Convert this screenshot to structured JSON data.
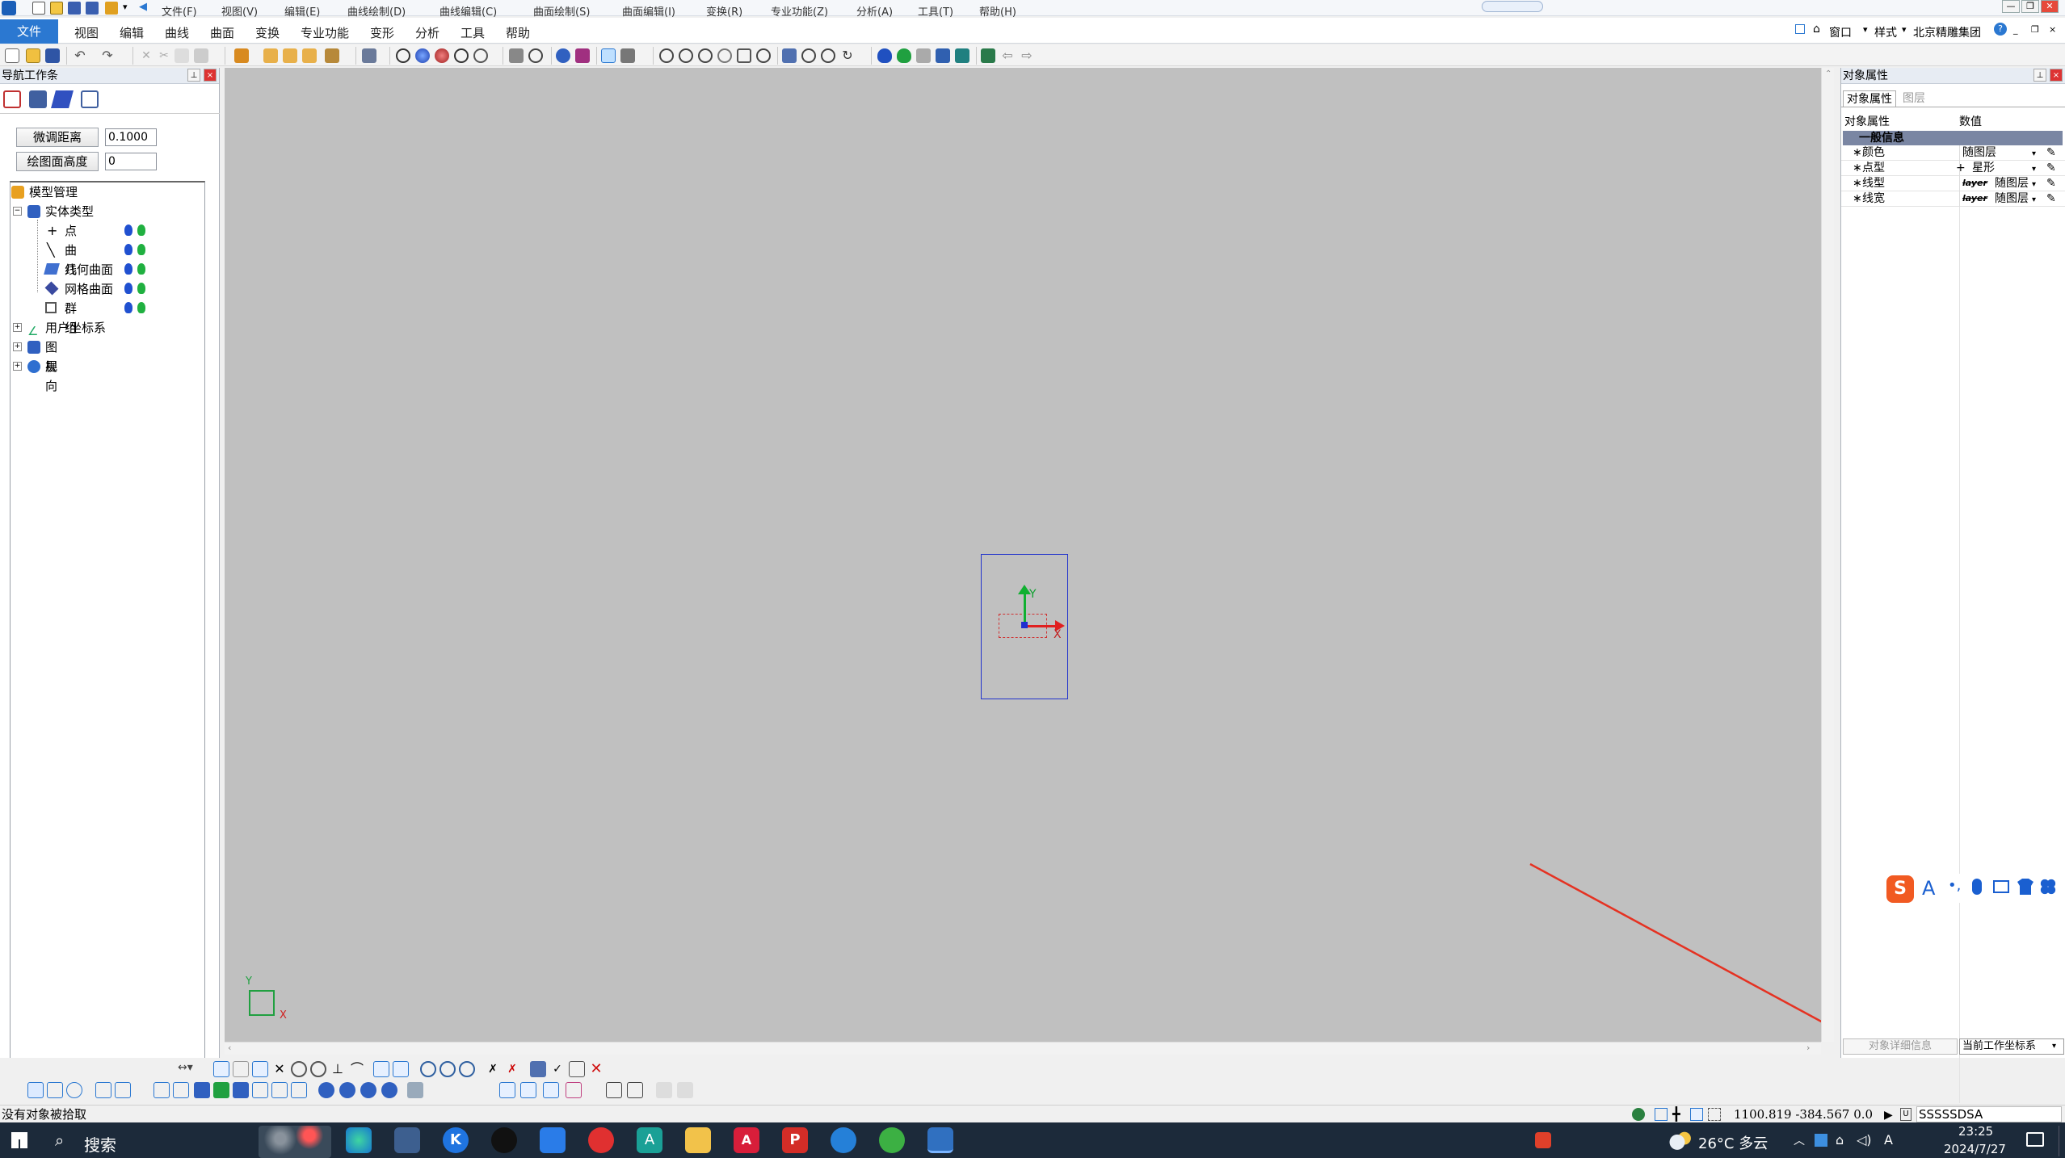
{
  "app": {
    "org_label": "北京精雕集团",
    "window_menu": "窗口",
    "style_menu": "样式"
  },
  "title_menu": [
    "文件(F)",
    "视图(V)",
    "编辑(E)",
    "曲线绘制(D)",
    "曲线编辑(C)",
    "曲面绘制(S)",
    "曲面编辑(I)",
    "变换(R)",
    "专业功能(Z)",
    "分析(A)",
    "工具(T)",
    "帮助(H)"
  ],
  "ribbon_tabs": [
    "文件",
    "视图",
    "编辑",
    "曲线",
    "曲面",
    "变换",
    "专业功能",
    "变形",
    "分析",
    "工具",
    "帮助"
  ],
  "left_panel": {
    "title": "导航工作条",
    "fine_adjust_label": "微调距离",
    "fine_adjust_value": "0.1000",
    "plane_height_label": "绘图面高度",
    "plane_height_value": "0",
    "tree": {
      "root": "模型管理",
      "entity_types": "实体类型",
      "children": [
        "点",
        "曲线",
        "几何曲面",
        "网格曲面",
        "群组"
      ],
      "ucs": "用户坐标系",
      "layers": "图层",
      "views": "视向"
    }
  },
  "right_panel": {
    "title": "对象属性",
    "tabs": [
      "对象属性",
      "图层"
    ],
    "col_headers": [
      "对象属性",
      "数值"
    ],
    "group": "一般信息",
    "rows": [
      {
        "name": "颜色",
        "value": "随图层"
      },
      {
        "name": "点型",
        "value": "星形"
      },
      {
        "name": "线型",
        "value": "随图层",
        "prefix": "layer"
      },
      {
        "name": "线宽",
        "value": "随图层",
        "prefix": "layer"
      }
    ],
    "footer_left": "对象详细信息",
    "footer_right": "当前工作坐标系"
  },
  "canvas": {
    "axis_x": "X",
    "axis_y": "Y",
    "corner_x": "X",
    "corner_y": "Y"
  },
  "status": {
    "message": "没有对象被拾取",
    "coords": "1100.819 -384.567 0.0",
    "command_input": "SSSSSDSA"
  },
  "taskbar": {
    "search": "搜索",
    "weather": "26°C 多云",
    "time": "23:25",
    "date": "2024/7/27"
  },
  "ime": {
    "label": "A"
  },
  "colors": {
    "canvas_bg": "#c0c0c0",
    "accent": "#2b78d1",
    "arrow": "#e53222"
  }
}
